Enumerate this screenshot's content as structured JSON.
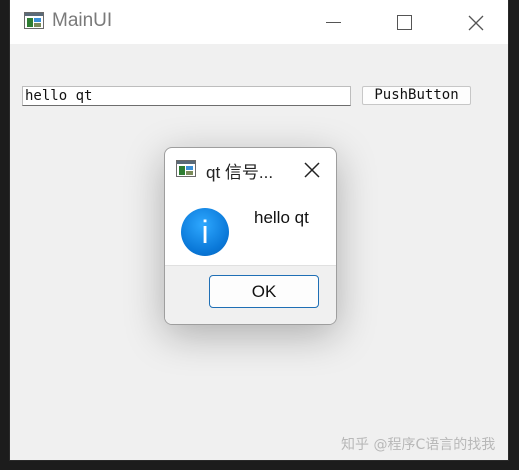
{
  "window": {
    "title": "MainUI",
    "icon": "qt-app-icon"
  },
  "main": {
    "line_edit_value": "hello qt",
    "push_button_label": "PushButton"
  },
  "dialog": {
    "title": "qt 信号...",
    "message": "hello qt",
    "ok_label": "OK",
    "icon": "info-icon"
  },
  "watermark": "知乎 @程序C语言的找我",
  "colors": {
    "accent": "#0a78d8",
    "ok_border": "#1f6fb5",
    "window_bg": "#f0f0f0"
  }
}
